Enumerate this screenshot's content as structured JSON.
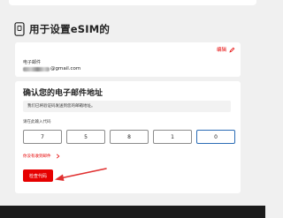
{
  "section": {
    "icon": "phone-icon",
    "title": "用于设置eSIM的"
  },
  "email_card": {
    "edit_label": "编辑",
    "edit_icon": "pencil-icon",
    "email_label": "电子邮件",
    "email_value_visible": "@gmail.com"
  },
  "verify": {
    "title": "确认您的电子邮件地址",
    "info": "我们已将验证码发送到您的邮箱地址。",
    "code_label": "请在此输入代码",
    "code_digits": [
      "7",
      "5",
      "8",
      "1",
      "0"
    ],
    "resend_label": "你没有收到邮件",
    "check_button": "检查代码"
  },
  "colors": {
    "accent": "#e60000",
    "focus_border": "#2b6cb5",
    "background": "#f0f0f0",
    "footer": "#1b1b1b"
  }
}
